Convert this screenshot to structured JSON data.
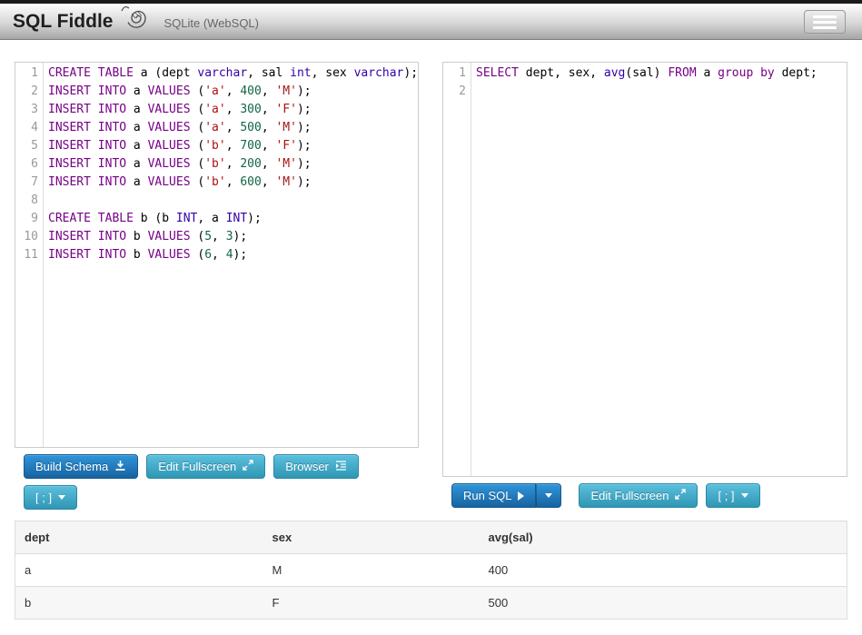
{
  "header": {
    "title": "SQL Fiddle",
    "subtitle": "SQLite (WebSQL)"
  },
  "schema_panel": {
    "lines": [
      [
        [
          "CREATE TABLE",
          "k"
        ],
        [
          " a (dept ",
          "p"
        ],
        [
          "varchar",
          "t"
        ],
        [
          ", sal ",
          "p"
        ],
        [
          "int",
          "t"
        ],
        [
          ", sex ",
          "p"
        ],
        [
          "varchar",
          "t"
        ],
        [
          ");",
          "p"
        ]
      ],
      [
        [
          "INSERT INTO",
          "k"
        ],
        [
          " a ",
          "p"
        ],
        [
          "VALUES",
          "k"
        ],
        [
          " (",
          "p"
        ],
        [
          "'a'",
          "s"
        ],
        [
          ", ",
          "p"
        ],
        [
          "400",
          "n"
        ],
        [
          ", ",
          "p"
        ],
        [
          "'M'",
          "s"
        ],
        [
          ");",
          "p"
        ]
      ],
      [
        [
          "INSERT INTO",
          "k"
        ],
        [
          " a ",
          "p"
        ],
        [
          "VALUES",
          "k"
        ],
        [
          " (",
          "p"
        ],
        [
          "'a'",
          "s"
        ],
        [
          ", ",
          "p"
        ],
        [
          "300",
          "n"
        ],
        [
          ", ",
          "p"
        ],
        [
          "'F'",
          "s"
        ],
        [
          ");",
          "p"
        ]
      ],
      [
        [
          "INSERT INTO",
          "k"
        ],
        [
          " a ",
          "p"
        ],
        [
          "VALUES",
          "k"
        ],
        [
          " (",
          "p"
        ],
        [
          "'a'",
          "s"
        ],
        [
          ", ",
          "p"
        ],
        [
          "500",
          "n"
        ],
        [
          ", ",
          "p"
        ],
        [
          "'M'",
          "s"
        ],
        [
          ");",
          "p"
        ]
      ],
      [
        [
          "INSERT INTO",
          "k"
        ],
        [
          " a ",
          "p"
        ],
        [
          "VALUES",
          "k"
        ],
        [
          " (",
          "p"
        ],
        [
          "'b'",
          "s"
        ],
        [
          ", ",
          "p"
        ],
        [
          "700",
          "n"
        ],
        [
          ", ",
          "p"
        ],
        [
          "'F'",
          "s"
        ],
        [
          ");",
          "p"
        ]
      ],
      [
        [
          "INSERT INTO",
          "k"
        ],
        [
          " a ",
          "p"
        ],
        [
          "VALUES",
          "k"
        ],
        [
          " (",
          "p"
        ],
        [
          "'b'",
          "s"
        ],
        [
          ", ",
          "p"
        ],
        [
          "200",
          "n"
        ],
        [
          ", ",
          "p"
        ],
        [
          "'M'",
          "s"
        ],
        [
          ");",
          "p"
        ]
      ],
      [
        [
          "INSERT INTO",
          "k"
        ],
        [
          " a ",
          "p"
        ],
        [
          "VALUES",
          "k"
        ],
        [
          " (",
          "p"
        ],
        [
          "'b'",
          "s"
        ],
        [
          ", ",
          "p"
        ],
        [
          "600",
          "n"
        ],
        [
          ", ",
          "p"
        ],
        [
          "'M'",
          "s"
        ],
        [
          ");",
          "p"
        ]
      ],
      [],
      [
        [
          "CREATE TABLE",
          "k"
        ],
        [
          " b (b ",
          "p"
        ],
        [
          "INT",
          "t"
        ],
        [
          ", a ",
          "p"
        ],
        [
          "INT",
          "t"
        ],
        [
          ");",
          "p"
        ]
      ],
      [
        [
          "INSERT INTO",
          "k"
        ],
        [
          " b ",
          "p"
        ],
        [
          "VALUES",
          "k"
        ],
        [
          " (",
          "p"
        ],
        [
          "5",
          "n"
        ],
        [
          ", ",
          "p"
        ],
        [
          "3",
          "n"
        ],
        [
          ");",
          "p"
        ]
      ],
      [
        [
          "INSERT INTO",
          "k"
        ],
        [
          " b ",
          "p"
        ],
        [
          "VALUES",
          "k"
        ],
        [
          " (",
          "p"
        ],
        [
          "6",
          "n"
        ],
        [
          ", ",
          "p"
        ],
        [
          "4",
          "n"
        ],
        [
          ");",
          "p"
        ]
      ]
    ],
    "buttons": {
      "build_schema": "Build Schema",
      "edit_fullscreen": "Edit Fullscreen",
      "browser": "Browser",
      "terminator": "[ ; ]"
    }
  },
  "query_panel": {
    "lines": [
      [
        [
          "SELECT",
          "k"
        ],
        [
          " dept, sex, ",
          "p"
        ],
        [
          "avg",
          "t"
        ],
        [
          "(sal) ",
          "p"
        ],
        [
          "FROM",
          "k"
        ],
        [
          " a ",
          "p"
        ],
        [
          "group",
          "k"
        ],
        [
          " ",
          "p"
        ],
        [
          "by",
          "k"
        ],
        [
          " dept;",
          "p"
        ]
      ],
      []
    ],
    "buttons": {
      "run_sql": "Run SQL",
      "edit_fullscreen": "Edit Fullscreen",
      "terminator": "[ ; ]"
    }
  },
  "results": {
    "headers": [
      "dept",
      "sex",
      "avg(sal)"
    ],
    "rows": [
      [
        "a",
        "M",
        "400"
      ],
      [
        "b",
        "F",
        "500"
      ]
    ]
  },
  "colors": {
    "primary_button": "#17639f",
    "info_button": "#5bc0de",
    "syntax_keyword": "#770088",
    "syntax_builtin": "#3300aa",
    "syntax_string": "#aa1111",
    "syntax_number": "#116644"
  }
}
